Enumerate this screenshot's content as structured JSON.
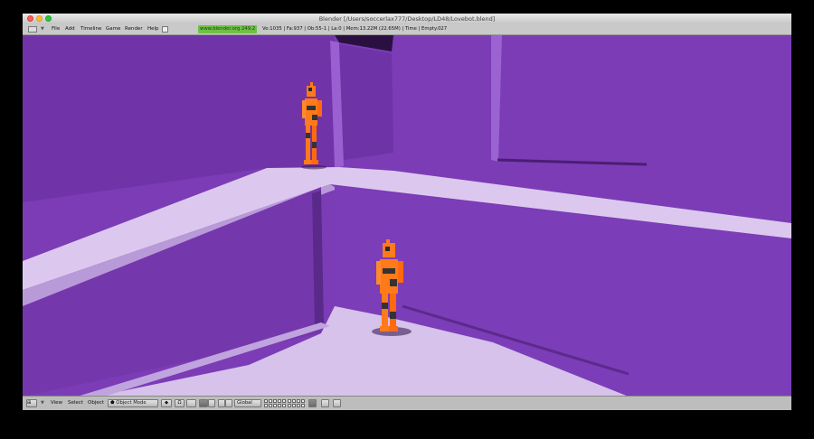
{
  "window": {
    "title": "Blender [/Users/soccerlax777/Desktop/LD48/Lovebot.blend]"
  },
  "menubar": {
    "header_icon": "info-window-icon",
    "items": [
      "File",
      "Add",
      "Timeline",
      "Game",
      "Render",
      "Help"
    ],
    "url": "www.blender.org 249.2",
    "stats": "Ve:1035 | Fa:937 | Ob:55-1 | La:0  | Mem:13.22M (22.65M)  | Time | Empty.027"
  },
  "footer": {
    "view_label": "View",
    "select_label": "Select",
    "object_label": "Object",
    "mode_value": "Object Mode",
    "orientation_value": "Global"
  },
  "colors": {
    "wall_purple": "#7b3cb6",
    "floor_lilac": "#d9c5ec",
    "robot_orange": "#ff7a1a"
  }
}
